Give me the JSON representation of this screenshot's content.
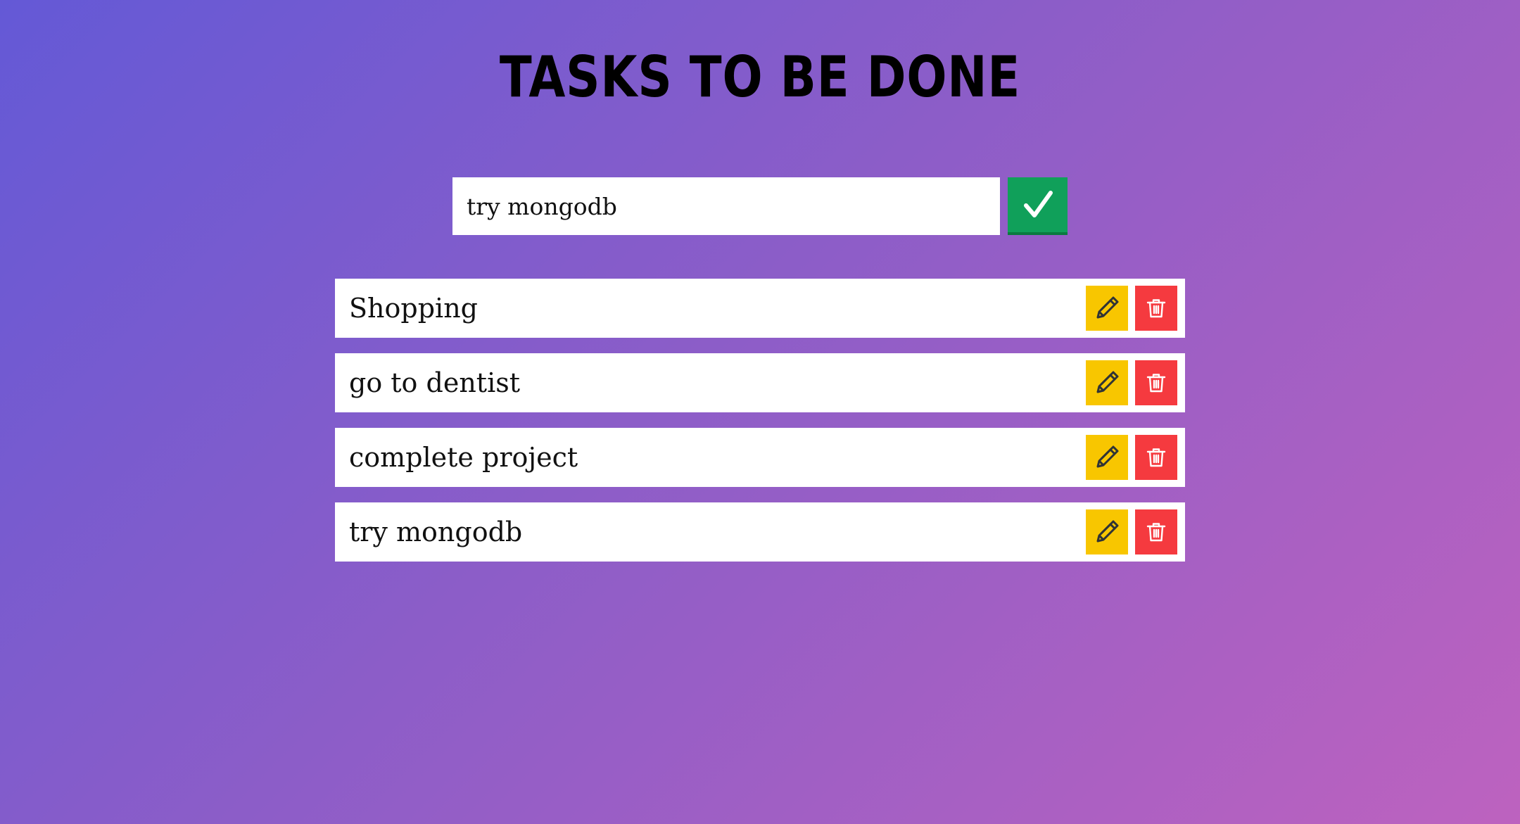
{
  "header": {
    "title": "TASKS TO BE DONE"
  },
  "add_form": {
    "input_value": "try mongodb"
  },
  "tasks": [
    {
      "text": "Shopping"
    },
    {
      "text": "go to dentist"
    },
    {
      "text": "complete project"
    },
    {
      "text": "try mongodb"
    }
  ],
  "icons": {
    "add": "check-icon",
    "edit": "pencil-icon",
    "delete": "trash-icon"
  },
  "colors": {
    "add_button": "#10a05a",
    "edit_button": "#f8c600",
    "delete_button": "#f53a3f",
    "background_start": "#6459d6",
    "background_end": "#bd62bf"
  }
}
